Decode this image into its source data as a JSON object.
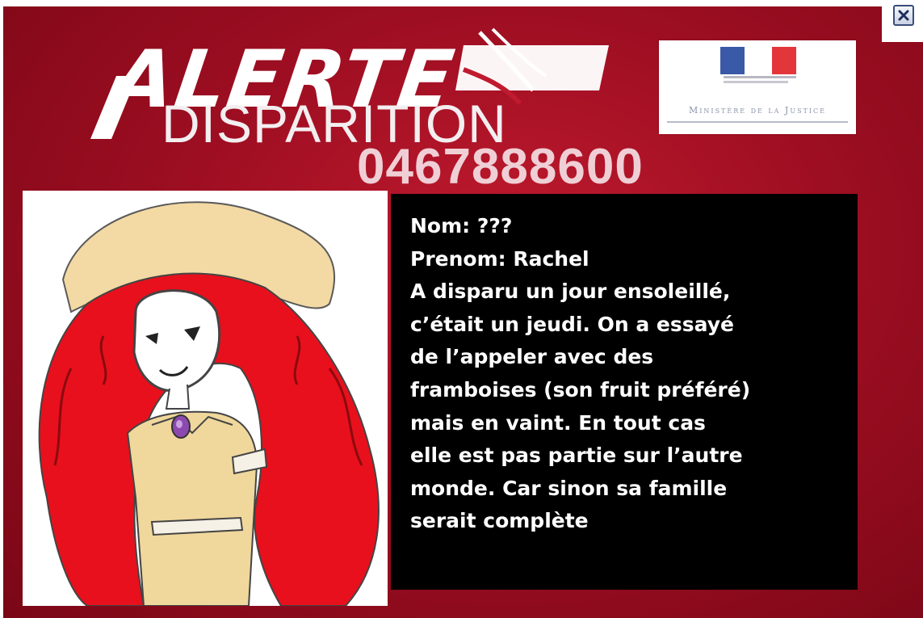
{
  "header": {
    "alerte": "ALERTE",
    "disparition": "DISPARITION",
    "phone": "0467888600"
  },
  "ministry": {
    "name": "Ministère de la Justice"
  },
  "window": {
    "close_icon": "close-icon"
  },
  "info": {
    "lines": [
      "Nom: ???",
      "Prenom: Rachel",
      "A disparu un jour ensoleillé,",
      "c’était un jeudi. On a essayé",
      "de l’appeler avec des",
      "framboises (son fruit préféré)",
      "mais en vaint. En tout cas",
      "elle est pas partie sur l’autre",
      "monde. Car sinon sa famille",
      "serait complète"
    ]
  },
  "colors": {
    "background_red": "#9e0e22",
    "info_background": "#000000",
    "hair_red": "#e8101c",
    "hat_beige": "#f3d9a3"
  }
}
